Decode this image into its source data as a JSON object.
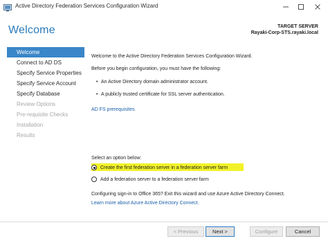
{
  "window": {
    "title": "Active Directory Federation Services Configuration Wizard",
    "icons": [
      "app-icon",
      "minimize-icon",
      "maximize-icon",
      "close-icon"
    ]
  },
  "header": {
    "page_title": "Welcome",
    "target_label": "TARGET SERVER",
    "target_value": "Rayaki-Corp-STS.rayaki.local"
  },
  "nav": {
    "items": [
      {
        "label": "Welcome",
        "state": "active"
      },
      {
        "label": "Connect to AD DS",
        "state": "enabled"
      },
      {
        "label": "Specify Service Properties",
        "state": "enabled"
      },
      {
        "label": "Specify Service Account",
        "state": "enabled"
      },
      {
        "label": "Specify Database",
        "state": "enabled"
      },
      {
        "label": "Review Options",
        "state": "disabled"
      },
      {
        "label": "Pre-requisite Checks",
        "state": "disabled"
      },
      {
        "label": "Installation",
        "state": "disabled"
      },
      {
        "label": "Results",
        "state": "disabled"
      }
    ]
  },
  "content": {
    "intro": "Welcome to the Active Directory Federation Services Configuration Wizard.",
    "before_begin": "Before you begin configuration, you must have the following:",
    "req1": "An Active Directory domain administrator account.",
    "req2": "A publicly trusted certificate for SSL server authentication.",
    "prereq_link": "AD FS prerequisites",
    "select_label": "Select an option below:",
    "option1": "Create the first federation server in a federation server farm",
    "option2": "Add a federation server to a federation server farm",
    "selected_option": "option1",
    "o365_text": "Configuring sign-in to Office 365? Exit this wizard and use Azure Active Directory Connect.",
    "aad_link": "Learn more about Azure Active Directory Connect."
  },
  "buttons": {
    "previous": "< Previous",
    "next": "Next >",
    "configure": "Configure",
    "cancel": "Cancel"
  },
  "colors": {
    "accent": "#2b7bb9",
    "nav_active": "#3a86c8",
    "link": "#1a5fa8",
    "highlight": "#f2f22a"
  }
}
